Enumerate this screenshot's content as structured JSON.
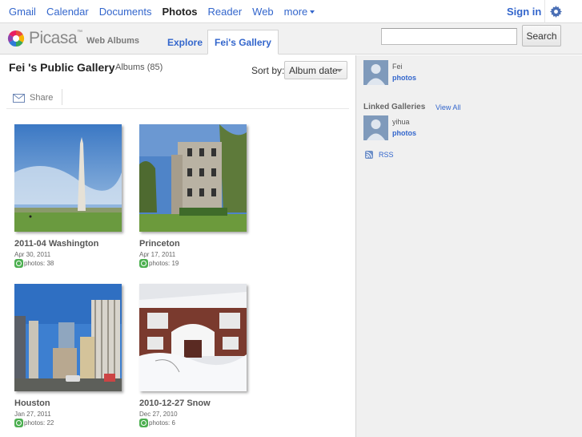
{
  "gbar": {
    "nav": [
      {
        "label": "Gmail",
        "selected": false
      },
      {
        "label": "Calendar",
        "selected": false
      },
      {
        "label": "Documents",
        "selected": false
      },
      {
        "label": "Photos",
        "selected": true
      },
      {
        "label": "Reader",
        "selected": false
      },
      {
        "label": "Web",
        "selected": false
      },
      {
        "label": "more",
        "selected": false
      }
    ],
    "signin": "Sign in",
    "settings_icon": "gear-icon"
  },
  "header": {
    "logo_word": "Picasa",
    "logo_tm": "™",
    "logo_sub": "Web Albums",
    "tabs": [
      {
        "label": "Explore"
      },
      {
        "label": "Fei's Gallery"
      }
    ],
    "search_value": "",
    "search_button": "Search"
  },
  "main": {
    "gallery_title": "Fei 's Public Gallery",
    "album_count": "Albums (85)",
    "sort_label": "Sort by:",
    "sort_value": "Album date",
    "share_label": "Share",
    "albums": [
      {
        "name": "2011-04 Washington",
        "date": "Apr 30, 2011",
        "photos": "photos: 38"
      },
      {
        "name": "Princeton",
        "date": "Apr 17, 2011",
        "photos": "photos: 19"
      },
      {
        "name": "Houston",
        "date": "Jan 27, 2011",
        "photos": "photos: 22"
      },
      {
        "name": "2010-12-27 Snow",
        "date": "Dec 27, 2010",
        "photos": "photos: 6"
      }
    ]
  },
  "side": {
    "owner_name": "Fei",
    "owner_link": "photos",
    "linked_title": "Linked Galleries",
    "view_all": "View All",
    "linked_name": "yihua",
    "linked_link": "photos",
    "rss": "RSS"
  },
  "colors": {
    "link": "#3366cc",
    "sidebar_bg": "#f0f0f0",
    "header_bg": "#f1f1f1"
  }
}
